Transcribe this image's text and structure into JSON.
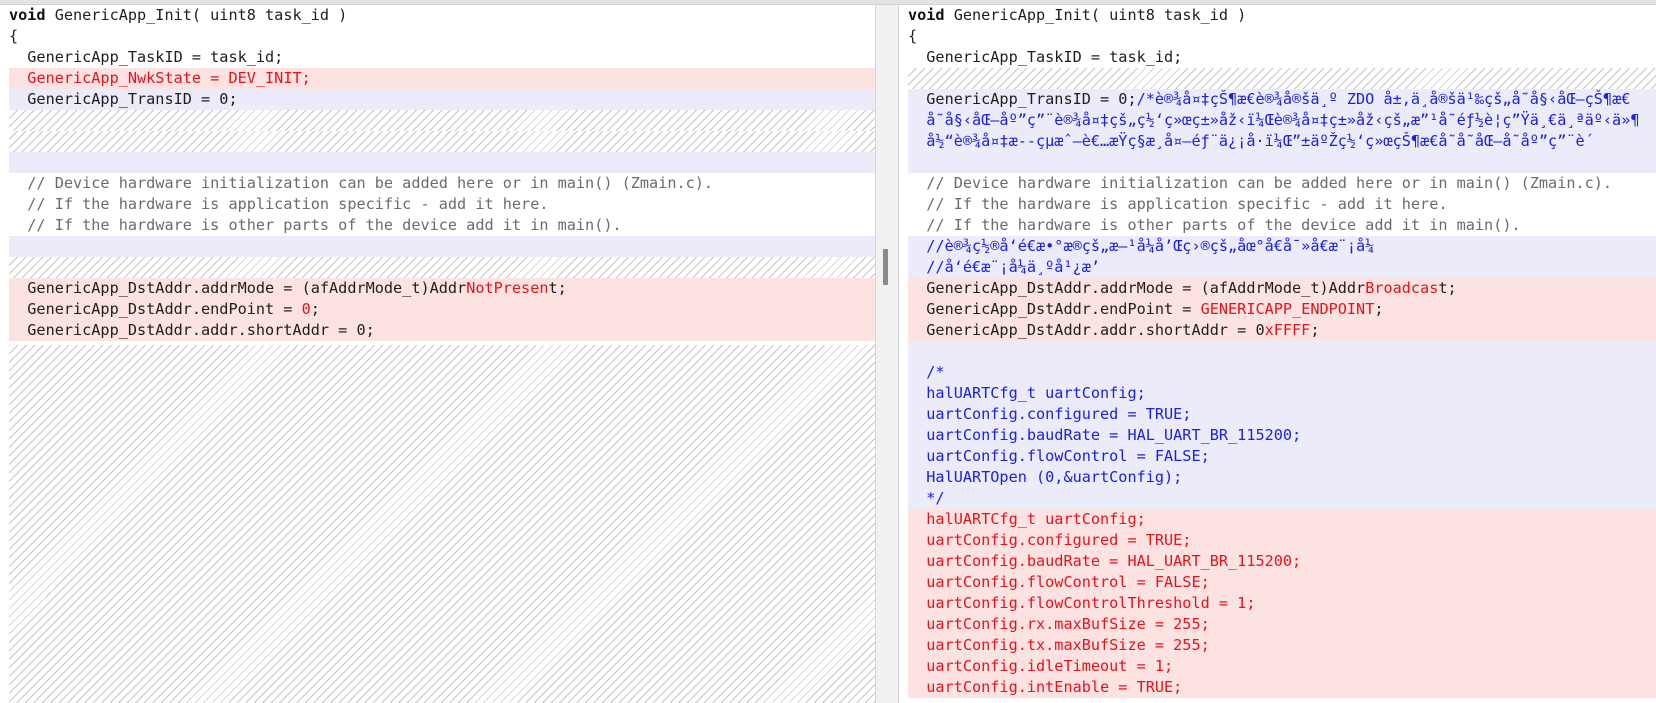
{
  "left": {
    "rows": [
      {
        "kind": "plain",
        "segs": [
          {
            "t": "void",
            "c": "k"
          },
          {
            "t": " GenericApp_Init( uint8 task_id )",
            "c": ""
          }
        ]
      },
      {
        "kind": "plain",
        "segs": [
          {
            "t": "{",
            "c": ""
          }
        ]
      },
      {
        "kind": "plain",
        "segs": [
          {
            "t": "  GenericApp_TaskID = task_id;",
            "c": ""
          }
        ]
      },
      {
        "kind": "del",
        "segs": [
          {
            "t": "  ",
            "c": ""
          },
          {
            "t": "GenericApp_NwkState = DEV_INIT;",
            "c": "r"
          }
        ]
      },
      {
        "kind": "chg",
        "segs": [
          {
            "t": "  GenericApp_TransID = 0;",
            "c": ""
          }
        ]
      },
      {
        "kind": "ph",
        "segs": []
      },
      {
        "kind": "ph",
        "segs": []
      },
      {
        "kind": "chg",
        "segs": []
      },
      {
        "kind": "plain",
        "segs": [
          {
            "t": "  // Device hardware initialization can be added here or in main() (Zmain.c).",
            "c": "cm"
          }
        ]
      },
      {
        "kind": "plain",
        "segs": [
          {
            "t": "  // If the hardware is application specific - add it here.",
            "c": "cm"
          }
        ]
      },
      {
        "kind": "plain",
        "segs": [
          {
            "t": "  // If the hardware is other parts of the device add it in main().",
            "c": "cm"
          }
        ]
      },
      {
        "kind": "chg",
        "segs": []
      },
      {
        "kind": "ph",
        "segs": []
      },
      {
        "kind": "del",
        "segs": [
          {
            "t": "  GenericApp_DstAddr.addrMode = (afAddrMode_t)Addr",
            "c": ""
          },
          {
            "t": "NotPresen",
            "c": "r"
          },
          {
            "t": "t;",
            "c": ""
          }
        ]
      },
      {
        "kind": "del",
        "segs": [
          {
            "t": "  GenericApp_DstAddr.endPoint = ",
            "c": ""
          },
          {
            "t": "0",
            "c": "r"
          },
          {
            "t": ";",
            "c": ""
          }
        ]
      },
      {
        "kind": "del",
        "segs": [
          {
            "t": "  GenericApp_DstAddr.addr.shortAddr = 0;",
            "c": ""
          }
        ]
      }
    ]
  },
  "right": {
    "rows": [
      {
        "kind": "plain",
        "segs": [
          {
            "t": "void",
            "c": "k"
          },
          {
            "t": " GenericApp_Init( uint8 task_id )",
            "c": ""
          }
        ]
      },
      {
        "kind": "plain",
        "segs": [
          {
            "t": "{",
            "c": ""
          }
        ]
      },
      {
        "kind": "plain",
        "segs": [
          {
            "t": "  GenericApp_TaskID = task_id;",
            "c": ""
          }
        ]
      },
      {
        "kind": "ph",
        "segs": []
      },
      {
        "kind": "chg",
        "segs": [
          {
            "t": "  GenericApp_TransID = 0;",
            "c": ""
          },
          {
            "t": "/*è®¾å¤‡çŠ¶æ€è®¾å®šä¸º ZDO å±‚ä¸­å®šä¹‰çš„å˜å§‹åŒ–çŠ¶æ€",
            "c": "b"
          }
        ]
      },
      {
        "kind": "chg",
        "segs": [
          {
            "t": "  å˜å§‹åŒ–åº”ç”¨è®¾å¤‡çš„ç½‘ç»œç±»åž‹ï¼Œè®¾å¤‡ç±»åž‹çš„æ”¹å˜éƒ½è¦ç”Ÿä¸€ä¸ªäº‹ä»¶",
            "c": "b"
          }
        ]
      },
      {
        "kind": "chg",
        "segs": [
          {
            "t": "  å½“è®¾å¤‡æ--çµæˆ–è€…æŸç§æ¸å¤–éƒ¨ä¿¡å·ï¼Œ”±äºŽç½‘ç»œçŠ¶æ€å˜å˜åŒ–å˜åº”ç”¨è´",
            "c": "b"
          }
        ]
      },
      {
        "kind": "chg",
        "segs": []
      },
      {
        "kind": "plain",
        "segs": [
          {
            "t": "  // Device hardware initialization can be added here or in main() (Zmain.c).",
            "c": "cm"
          }
        ]
      },
      {
        "kind": "plain",
        "segs": [
          {
            "t": "  // If the hardware is application specific - add it here.",
            "c": "cm"
          }
        ]
      },
      {
        "kind": "plain",
        "segs": [
          {
            "t": "  // If the hardware is other parts of the device add it in main().",
            "c": "cm"
          }
        ]
      },
      {
        "kind": "chg",
        "segs": [
          {
            "t": "  //è®¾ç½®å‘é€æ•°æ®çš„æ–¹å¼å’Œç›®çš„åœ°å€å¯»å€æ¨¡å¼",
            "c": "b"
          }
        ]
      },
      {
        "kind": "chg",
        "segs": [
          {
            "t": "  //å‘é€æ¨¡å¼ä¸ºå¹¿æ’­",
            "c": "b"
          }
        ]
      },
      {
        "kind": "del",
        "segs": [
          {
            "t": "  GenericApp_DstAddr.addrMode = (afAddrMode_t)Addr",
            "c": ""
          },
          {
            "t": "Broadcas",
            "c": "r"
          },
          {
            "t": "t;",
            "c": ""
          }
        ]
      },
      {
        "kind": "del",
        "segs": [
          {
            "t": "  GenericApp_DstAddr.endPoint = ",
            "c": ""
          },
          {
            "t": "GENERICAPP_ENDPOINT",
            "c": "r"
          },
          {
            "t": ";",
            "c": ""
          }
        ]
      },
      {
        "kind": "del",
        "segs": [
          {
            "t": "  GenericApp_DstAddr.addr.shortAddr = 0",
            "c": ""
          },
          {
            "t": "xFFFF",
            "c": "r"
          },
          {
            "t": ";",
            "c": ""
          }
        ]
      },
      {
        "kind": "chg",
        "segs": []
      },
      {
        "kind": "chg",
        "segs": [
          {
            "t": "  /*",
            "c": "b"
          }
        ]
      },
      {
        "kind": "chg",
        "segs": [
          {
            "t": "  halUARTCfg_t uartConfig;",
            "c": "b"
          }
        ]
      },
      {
        "kind": "chg",
        "segs": [
          {
            "t": "  uartConfig.configured = TRUE;",
            "c": "b"
          }
        ]
      },
      {
        "kind": "chg",
        "segs": [
          {
            "t": "  uartConfig.baudRate = HAL_UART_BR_115200;",
            "c": "b"
          }
        ]
      },
      {
        "kind": "chg",
        "segs": [
          {
            "t": "  uartConfig.flowControl = FALSE;",
            "c": "b"
          }
        ]
      },
      {
        "kind": "chg",
        "segs": [
          {
            "t": "  HalUARTOpen (0,&uartConfig);",
            "c": "b"
          }
        ]
      },
      {
        "kind": "chg",
        "segs": [
          {
            "t": "  */",
            "c": "b"
          }
        ]
      },
      {
        "kind": "del",
        "segs": [
          {
            "t": "  halUARTCfg_t uartConfig;",
            "c": "r"
          }
        ]
      },
      {
        "kind": "del",
        "segs": [
          {
            "t": "  uartConfig.configured = TRUE;",
            "c": "r"
          }
        ]
      },
      {
        "kind": "del",
        "segs": [
          {
            "t": "  uartConfig.baudRate = HAL_UART_BR_115200;",
            "c": "r"
          }
        ]
      },
      {
        "kind": "del",
        "segs": [
          {
            "t": "  uartConfig.flowControl = FALSE;",
            "c": "r"
          }
        ]
      },
      {
        "kind": "del",
        "segs": [
          {
            "t": "  uartConfig.flowControlThreshold = 1;",
            "c": "r"
          }
        ]
      },
      {
        "kind": "del",
        "segs": [
          {
            "t": "  uartConfig.rx.maxBufSize = 255;",
            "c": "r"
          }
        ]
      },
      {
        "kind": "del",
        "segs": [
          {
            "t": "  uartConfig.tx.maxBufSize = 255;",
            "c": "r"
          }
        ]
      },
      {
        "kind": "del",
        "segs": [
          {
            "t": "  uartConfig.idleTimeout = 1;",
            "c": "r"
          }
        ]
      },
      {
        "kind": "del",
        "segs": [
          {
            "t": "  uartConfig.intEnable = TRUE;",
            "c": "r"
          }
        ]
      }
    ]
  }
}
